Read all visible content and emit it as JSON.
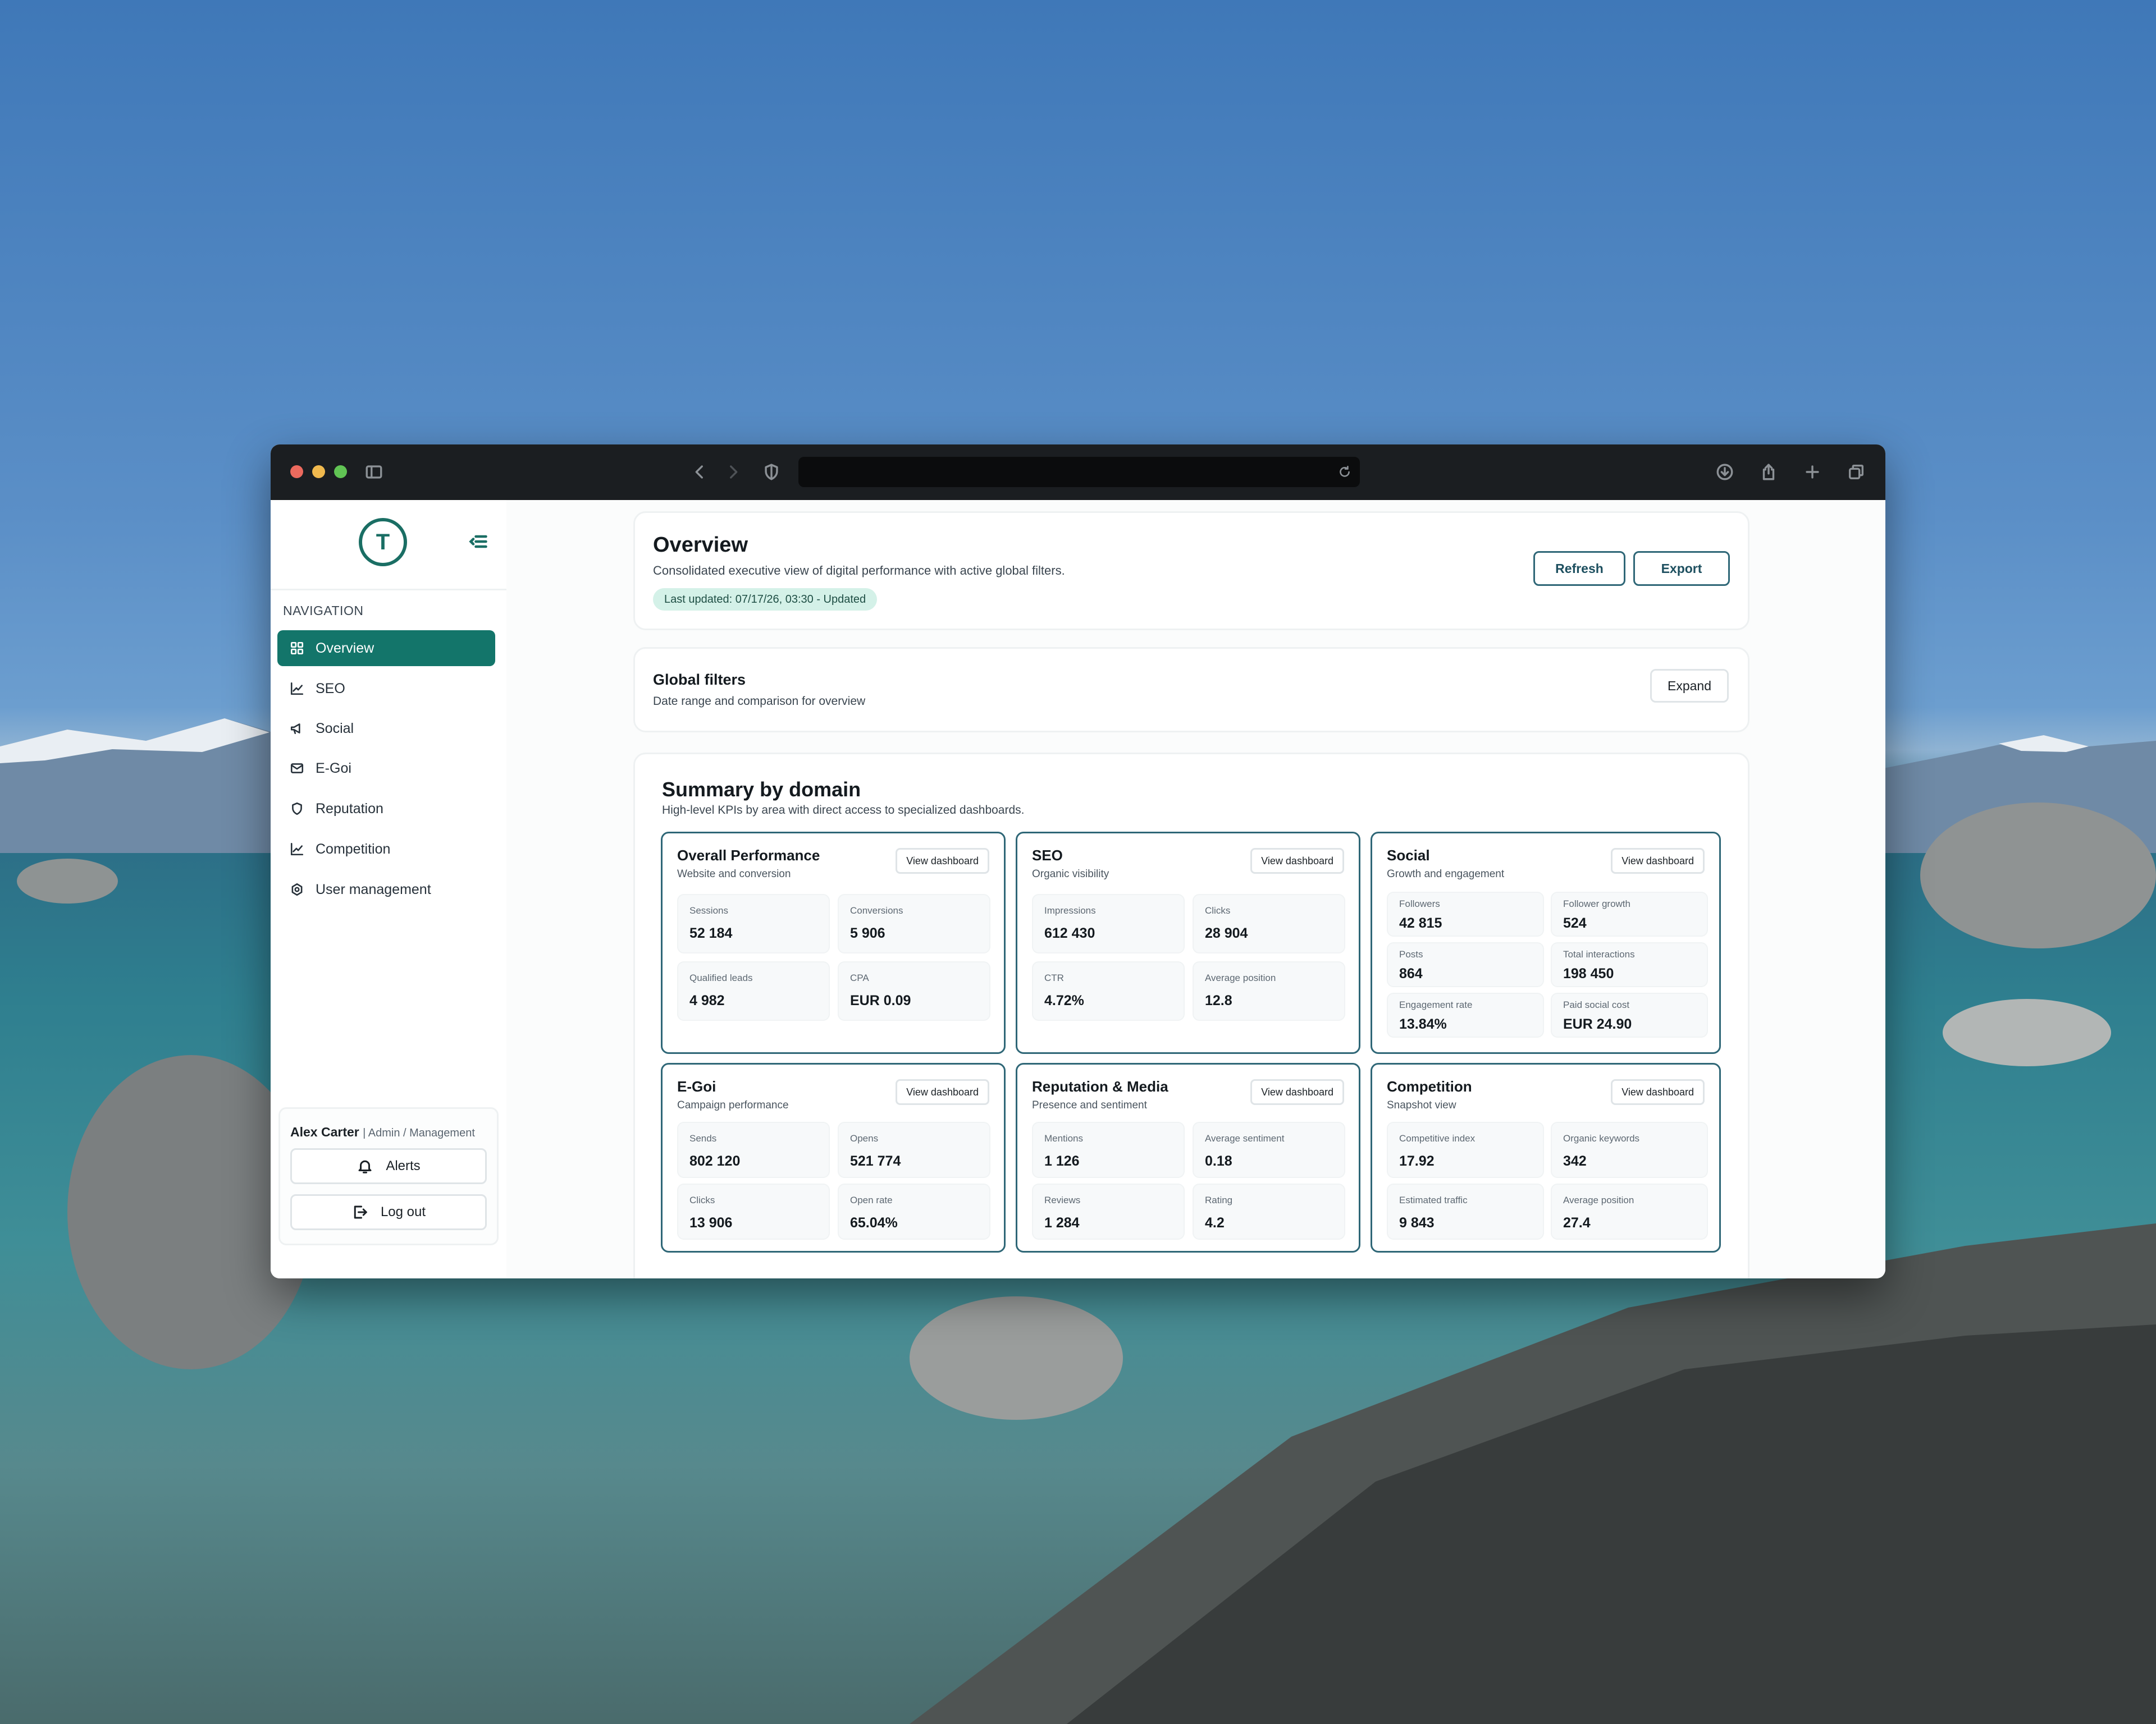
{
  "colors": {
    "accent": "#13756a",
    "outline": "#2f6777",
    "badge_bg": "#d4f1e8"
  },
  "browser": {
    "icons": [
      "sidebar-toggle-icon",
      "back-icon",
      "forward-icon",
      "shield-icon",
      "reload-icon",
      "download-icon",
      "share-icon",
      "new-tab-icon",
      "tabs-overview-icon"
    ]
  },
  "sidebar": {
    "logo_letter": "T",
    "nav_heading": "NAVIGATION",
    "items": [
      {
        "label": "Overview",
        "icon": "grid-icon"
      },
      {
        "label": "SEO",
        "icon": "chart-icon"
      },
      {
        "label": "Social",
        "icon": "megaphone-icon"
      },
      {
        "label": "E-Goi",
        "icon": "mail-icon"
      },
      {
        "label": "Reputation",
        "icon": "shield-icon"
      },
      {
        "label": "Competition",
        "icon": "chart-icon"
      },
      {
        "label": "User management",
        "icon": "settings-icon"
      }
    ],
    "user": {
      "name": "Alex Carter",
      "role": "| Admin / Management"
    },
    "alerts_label": "Alerts",
    "logout_label": "Log out"
  },
  "overview": {
    "title": "Overview",
    "subtitle": "Consolidated executive view of digital performance with active global filters.",
    "badge": "Last updated: 07/17/26, 03:30 - Updated",
    "refresh_label": "Refresh",
    "export_label": "Export"
  },
  "filters": {
    "title": "Global filters",
    "subtitle": "Date range and comparison for overview",
    "expand_label": "Expand"
  },
  "summary": {
    "title": "Summary by domain",
    "subtitle": "High-level KPIs by area with direct access to specialized dashboards.",
    "view_label": "View dashboard",
    "domains": [
      {
        "title": "Overall Performance",
        "subtitle": "Website and conversion",
        "kpis": [
          {
            "label": "Sessions",
            "value": "52 184"
          },
          {
            "label": "Conversions",
            "value": "5 906"
          },
          {
            "label": "Qualified leads",
            "value": "4 982"
          },
          {
            "label": "CPA",
            "value": "EUR 0.09"
          }
        ]
      },
      {
        "title": "SEO",
        "subtitle": "Organic visibility",
        "kpis": [
          {
            "label": "Impressions",
            "value": "612 430"
          },
          {
            "label": "Clicks",
            "value": "28 904"
          },
          {
            "label": "CTR",
            "value": "4.72%"
          },
          {
            "label": "Average position",
            "value": "12.8"
          }
        ]
      },
      {
        "title": "Social",
        "subtitle": "Growth and engagement",
        "kpis": [
          {
            "label": "Followers",
            "value": "42 815"
          },
          {
            "label": "Follower growth",
            "value": "524"
          },
          {
            "label": "Posts",
            "value": "864"
          },
          {
            "label": "Total interactions",
            "value": "198 450"
          },
          {
            "label": "Engagement rate",
            "value": "13.84%"
          },
          {
            "label": "Paid social cost",
            "value": "EUR 24.90"
          }
        ]
      },
      {
        "title": "E-Goi",
        "subtitle": "Campaign performance",
        "kpis": [
          {
            "label": "Sends",
            "value": "802 120"
          },
          {
            "label": "Opens",
            "value": "521 774"
          },
          {
            "label": "Clicks",
            "value": "13 906"
          },
          {
            "label": "Open rate",
            "value": "65.04%"
          }
        ]
      },
      {
        "title": "Reputation & Media",
        "subtitle": "Presence and sentiment",
        "kpis": [
          {
            "label": "Mentions",
            "value": "1 126"
          },
          {
            "label": "Average sentiment",
            "value": "0.18"
          },
          {
            "label": "Reviews",
            "value": "1 284"
          },
          {
            "label": "Rating",
            "value": "4.2"
          }
        ]
      },
      {
        "title": "Competition",
        "subtitle": "Snapshot view",
        "kpis": [
          {
            "label": "Competitive index",
            "value": "17.92"
          },
          {
            "label": "Organic keywords",
            "value": "342"
          },
          {
            "label": "Estimated traffic",
            "value": "9 843"
          },
          {
            "label": "Average position",
            "value": "27.4"
          }
        ]
      }
    ]
  }
}
